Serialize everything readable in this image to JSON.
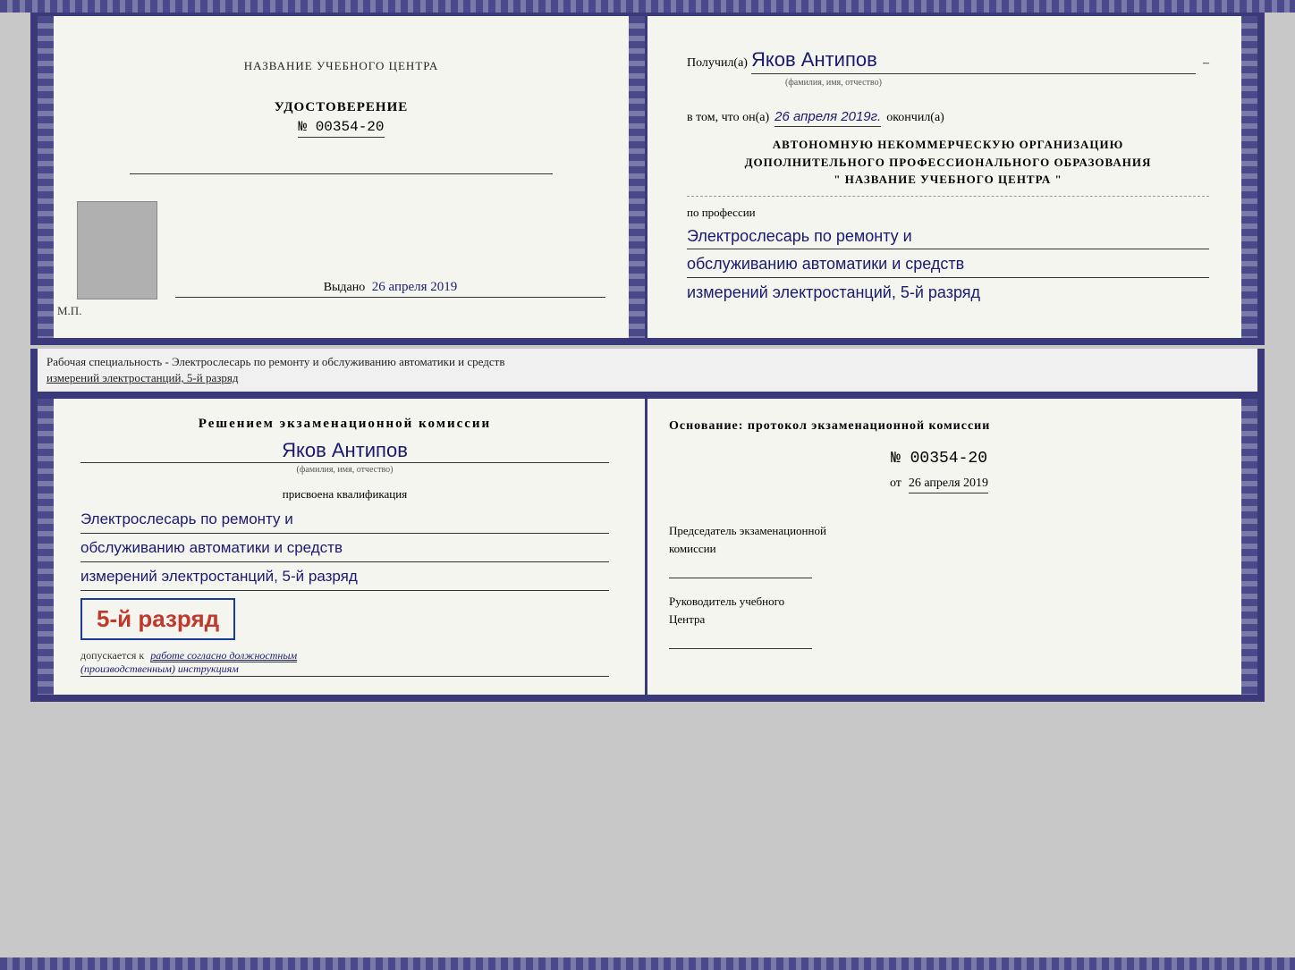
{
  "top_document": {
    "left": {
      "center_title": "НАЗВАНИЕ УЧЕБНОГО ЦЕНТРА",
      "udostoverenie_label": "УДОСТОВЕРЕНИЕ",
      "doc_number": "№ 00354-20",
      "vudano_prefix": "Выдано",
      "vudano_date": "26 апреля 2019",
      "mp_label": "М.П."
    },
    "right": {
      "poluchil_prefix": "Получил(а)",
      "recipient_name": "Яков Антипов",
      "fio_hint": "(фамилия, имя, отчество)",
      "vtom_prefix": "в том, что он(а)",
      "vtom_date": "26 апреля 2019г.",
      "okonchil": "окончил(а)",
      "org_line1": "АВТОНОМНУЮ НЕКОММЕРЧЕСКУЮ ОРГАНИЗАЦИЮ",
      "org_line2": "ДОПОЛНИТЕЛЬНОГО ПРОФЕССИОНАЛЬНОГО ОБРАЗОВАНИЯ",
      "org_line3": "\"  НАЗВАНИЕ УЧЕБНОГО ЦЕНТРА  \"",
      "po_professii": "по профессии",
      "profession_line1": "Электрослесарь по ремонту и",
      "profession_line2": "обслуживанию автоматики и средств",
      "profession_line3": "измерений электростанций, 5-й разряд"
    }
  },
  "separator": {
    "text_line1": "Рабочая специальность - Электрослесарь по ремонту и обслуживанию автоматики и средств",
    "text_line2": "измерений электростанций, 5-й разряд"
  },
  "bottom_document": {
    "left": {
      "resheniem_text": "Решением экзаменационной комиссии",
      "recipient_name": "Яков Антипов",
      "fio_hint": "(фамилия, имя, отчество)",
      "prisvoena": "присвоена квалификация",
      "prof_line1": "Электрослесарь по ремонту и",
      "prof_line2": "обслуживанию автоматики и средств",
      "prof_line3": "измерений электростанций, 5-й разряд",
      "rank_text": "5-й разряд",
      "dopuskaetsya_prefix": "допускается к",
      "dopuskaetsya_underlined": "работе согласно должностным",
      "dopuskaetsya_italic": "(производственным) инструкциям"
    },
    "right": {
      "osnovanie_text": "Основание: протокол экзаменационной комиссии",
      "number_label": "№ 00354-20",
      "ot_prefix": "от",
      "ot_date": "26 апреля 2019",
      "predsedatel_text": "Председатель экзаменационной",
      "komissi_text": "комиссии",
      "rukovoditel_line1": "Руководитель учебного",
      "rukovoditel_line2": "Центра"
    }
  }
}
